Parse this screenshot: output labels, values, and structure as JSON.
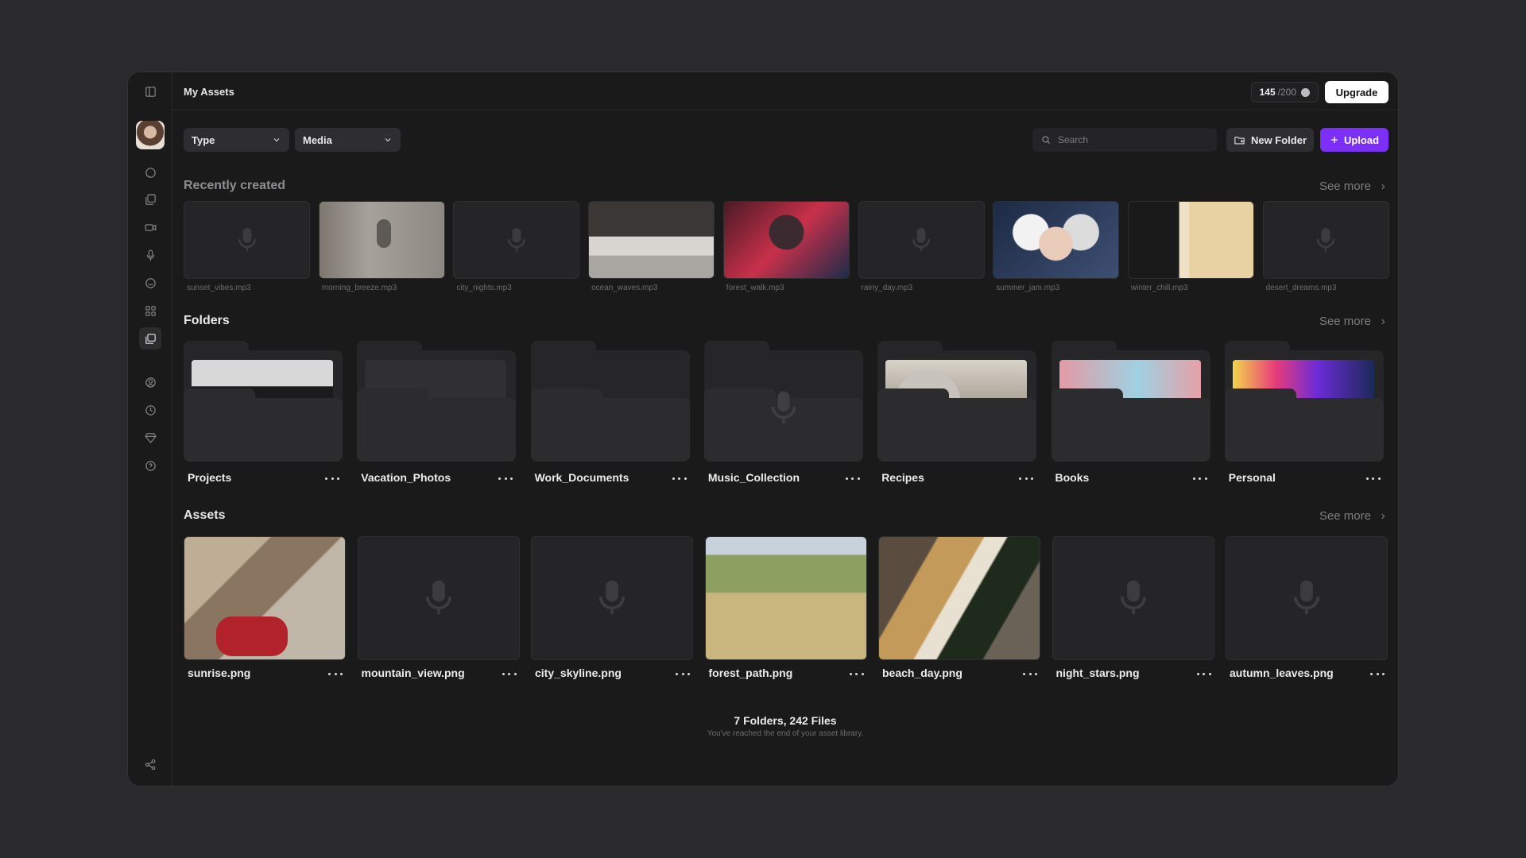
{
  "header": {
    "title": "My Assets",
    "credits_used": "145",
    "credits_total": "/200",
    "upgrade_label": "Upgrade"
  },
  "toolbar": {
    "type_label": "Type",
    "media_label": "Media",
    "search_placeholder": "Search",
    "new_folder_label": "New Folder",
    "upload_label": "Upload"
  },
  "colors": {
    "accent": "#7b2ff7",
    "background": "#1a1a1b"
  },
  "recent": {
    "title": "Recently created",
    "see_more": "See more",
    "items": [
      {
        "label": "sunset_vibes.mp3"
      },
      {
        "label": "morning_breeze.mp3"
      },
      {
        "label": "city_nights.mp3"
      },
      {
        "label": "ocean_waves.mp3"
      },
      {
        "label": "forest_walk.mp3"
      },
      {
        "label": "rainy_day.mp3"
      },
      {
        "label": "summer_jam.mp3"
      },
      {
        "label": "winter_chill.mp3"
      },
      {
        "label": "desert_dreams.mp3"
      }
    ]
  },
  "folders": {
    "title": "Folders",
    "see_more": "See more",
    "items": [
      {
        "name": "Projects"
      },
      {
        "name": "Vacation_Photos"
      },
      {
        "name": "Work_Documents"
      },
      {
        "name": "Music_Collection"
      },
      {
        "name": "Recipes"
      },
      {
        "name": "Books"
      },
      {
        "name": "Personal"
      }
    ]
  },
  "assets": {
    "title": "Assets",
    "see_more": "See more",
    "items": [
      {
        "name": "sunrise.png"
      },
      {
        "name": "mountain_view.png"
      },
      {
        "name": "city_skyline.png"
      },
      {
        "name": "forest_path.png"
      },
      {
        "name": "beach_day.png"
      },
      {
        "name": "night_stars.png"
      },
      {
        "name": "autumn_leaves.png"
      }
    ]
  },
  "footer": {
    "summary": "7 Folders, 242 Files",
    "subtext": "You've reached the end of your asset library."
  }
}
